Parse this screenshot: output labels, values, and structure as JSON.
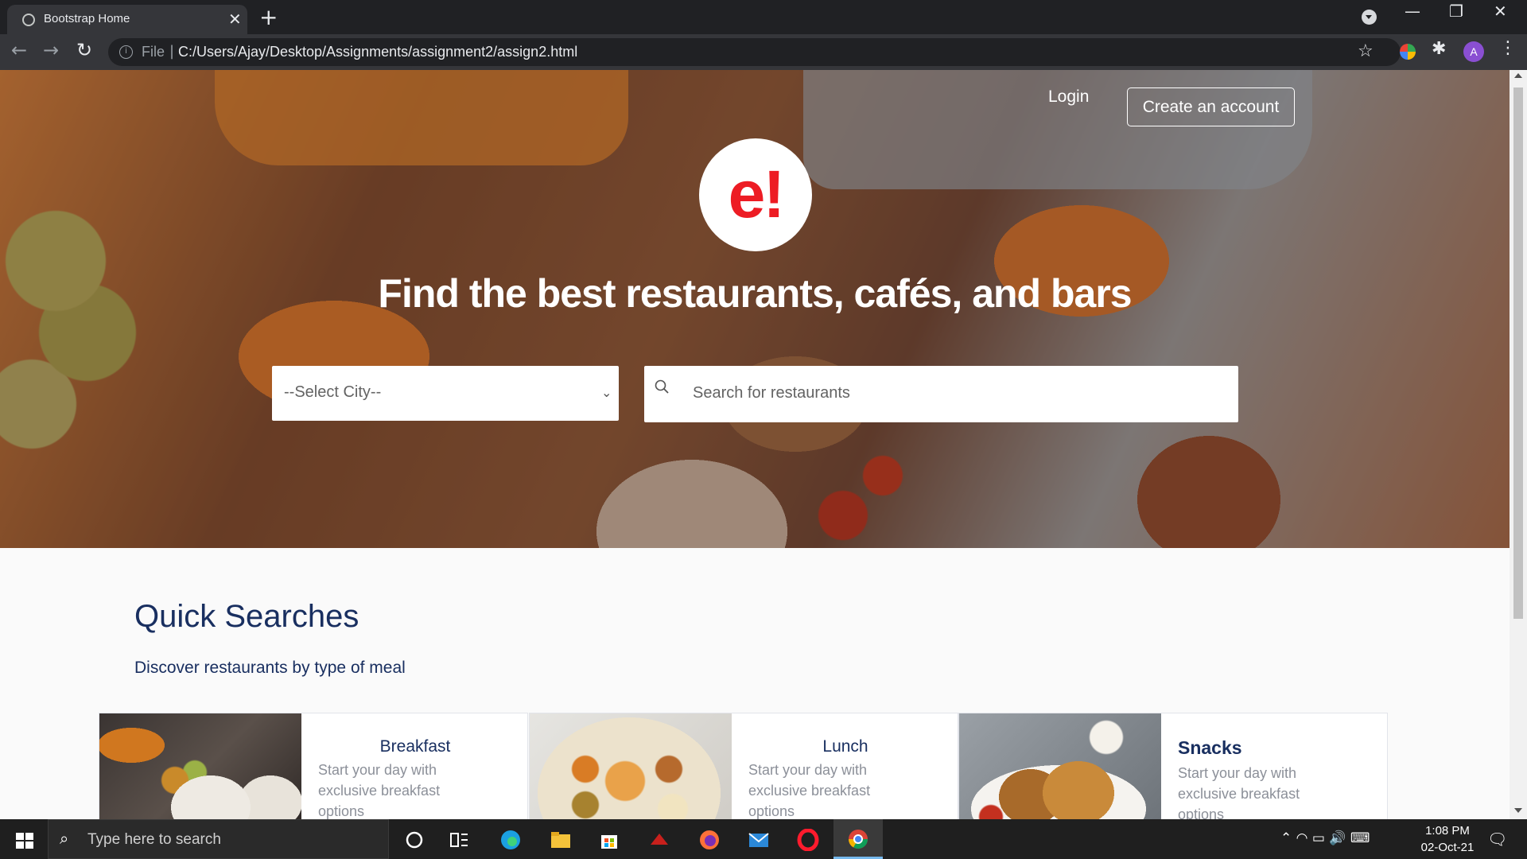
{
  "browser": {
    "tab_title": "Bootstrap Home",
    "tab_close_glyph": "✕",
    "new_tab_glyph": "+",
    "window_controls": {
      "minimize": "—",
      "restore": "❐",
      "close": "✕"
    },
    "nav": {
      "back": "←",
      "forward": "→",
      "reload": "↻"
    },
    "scheme_label": "File",
    "separator": "|",
    "url": "C:/Users/Ajay/Desktop/Assignments/assignment2/assign2.html",
    "bookmark_glyph": "☆",
    "extensions_glyph": "✱",
    "profile_initial": "A",
    "menu_glyph": "⋮"
  },
  "header": {
    "login_label": "Login",
    "signup_label": "Create an account"
  },
  "hero": {
    "logo_text": "e!",
    "headline": "Find the best restaurants, cafés, and bars",
    "city_select": {
      "selected": "--Select City--",
      "chevron": "⌄"
    },
    "search": {
      "placeholder": "Search for restaurants"
    }
  },
  "quick_searches": {
    "title": "Quick Searches",
    "subtitle": "Discover restaurants by type of meal",
    "cards": [
      {
        "name": "Breakfast",
        "description": "Start your day with exclusive breakfast options"
      },
      {
        "name": "Lunch",
        "description": "Start your day with exclusive breakfast options"
      },
      {
        "name": "Snacks",
        "description": "Start your day with exclusive breakfast options"
      }
    ]
  },
  "taskbar": {
    "search_placeholder": "Type here to search",
    "search_glyph": "⌕",
    "tray_glyphs": "⌃  ◠  ▭  🔊  ⌨",
    "time": "1:08 PM",
    "date": "02-Oct-21",
    "notification_glyph": "🗨"
  },
  "colors": {
    "brand_red": "#ed1c24",
    "heading_navy": "#192f60",
    "muted_text": "#8c9099"
  }
}
